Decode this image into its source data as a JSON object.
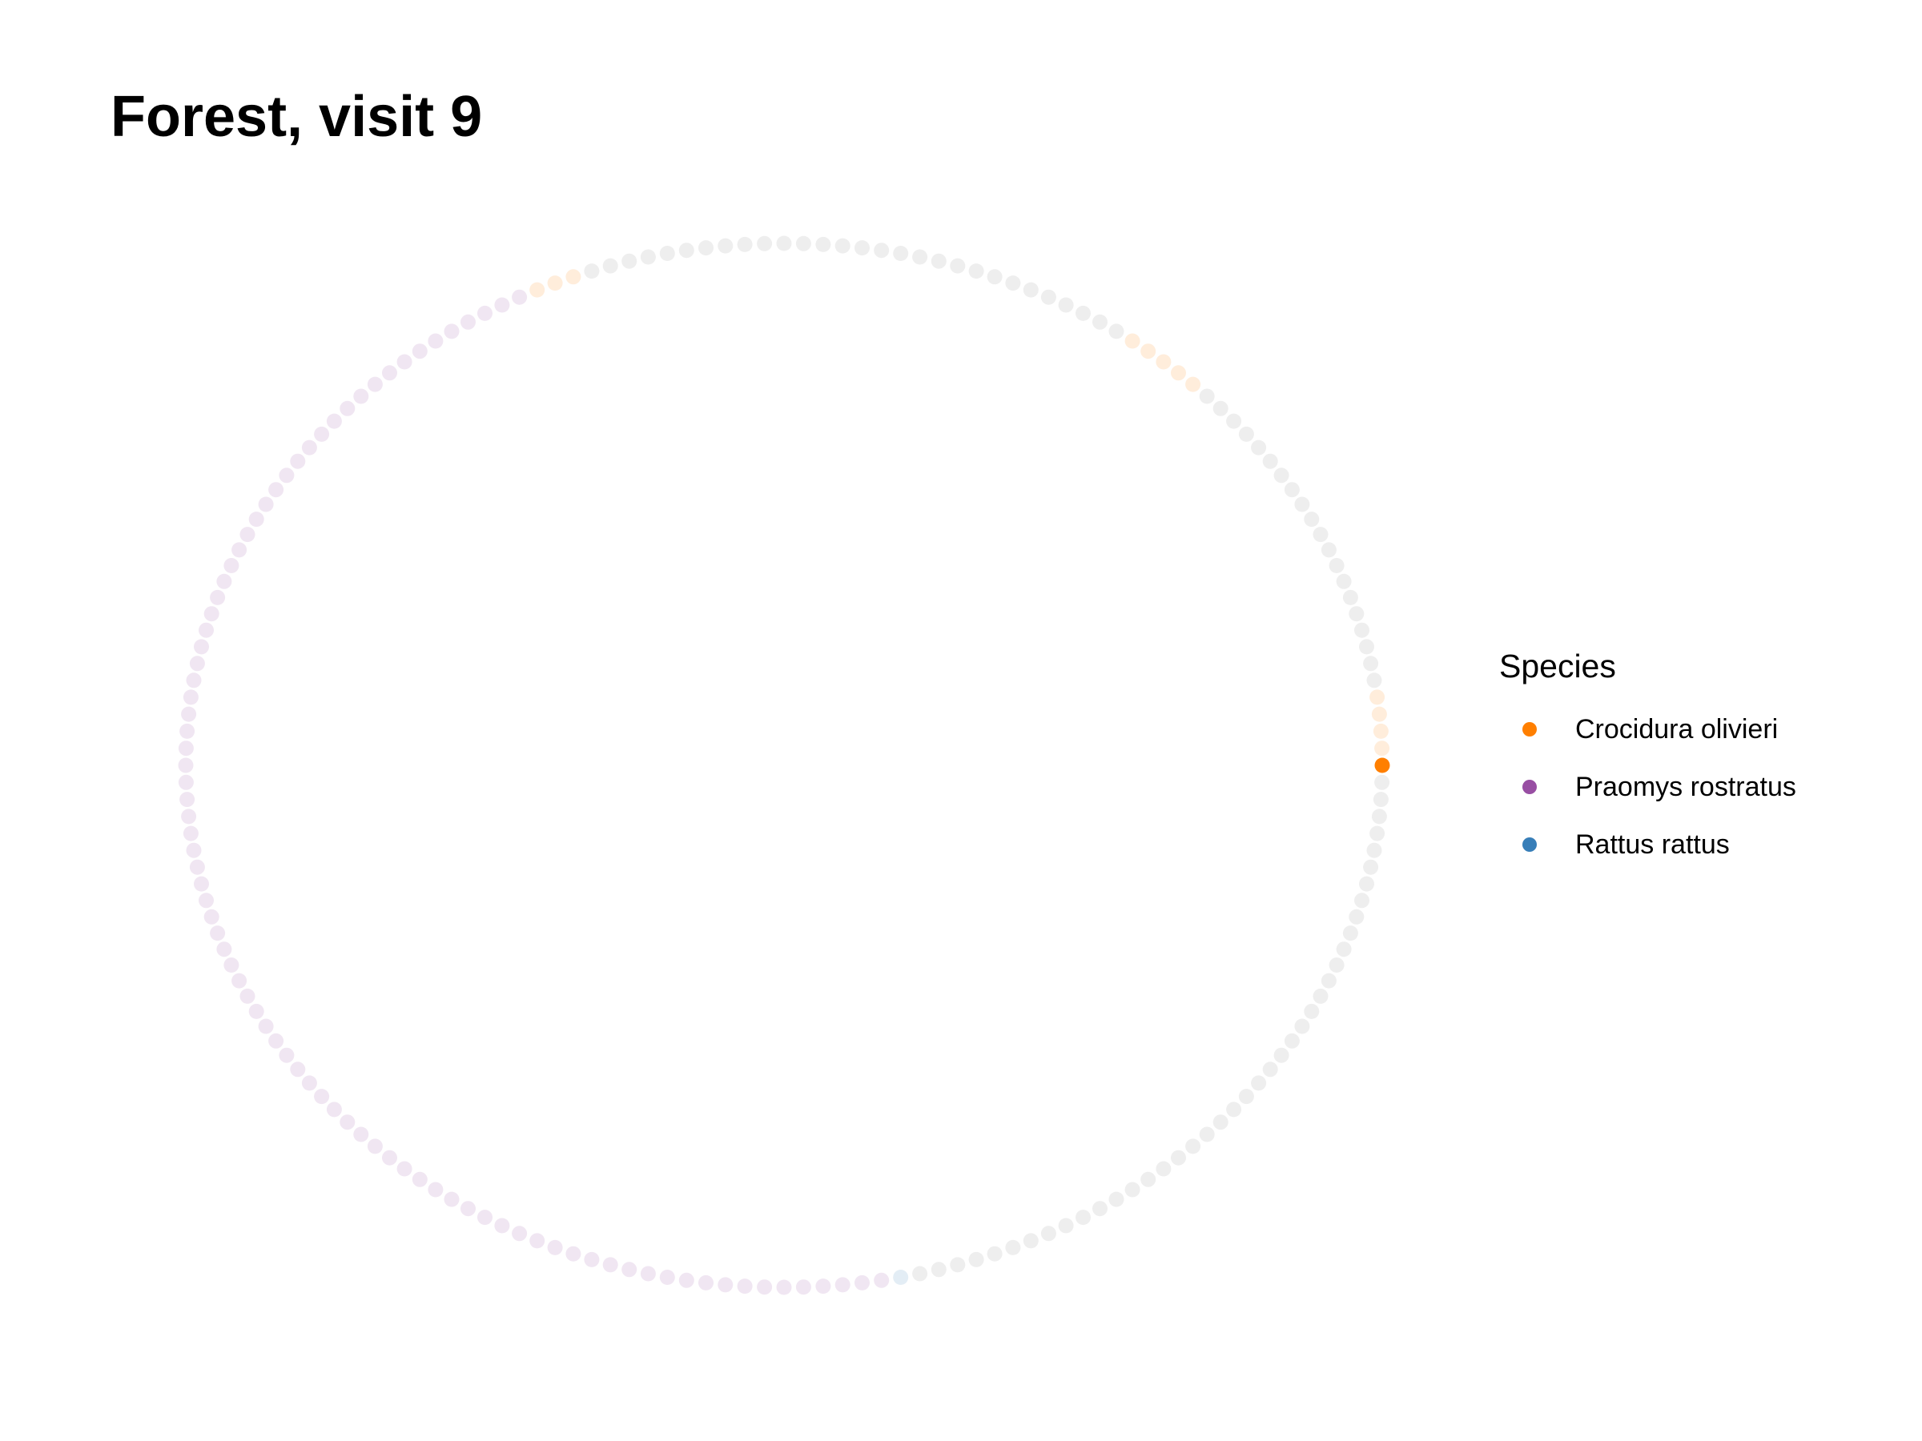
{
  "chart_data": {
    "type": "scatter",
    "subtype": "circular-dot-ring",
    "title": "Forest, visit 9",
    "legend": {
      "title": "Species",
      "placement": "right",
      "entries": [
        {
          "name": "Crocidura olivieri",
          "color": "#FF7F00"
        },
        {
          "name": "Praomys rostratus",
          "color": "#984EA3"
        },
        {
          "name": "Rattus rattus",
          "color": "#377EB8"
        }
      ]
    },
    "grid": false,
    "axes_visible": false,
    "point_count": 192,
    "highlighted_index": 0,
    "colors": {
      "faded": "#D9D9D9"
    },
    "segments": [
      {
        "species": null,
        "start": 0,
        "end": 0,
        "highlight": true,
        "comment_species": "Crocidura olivieri"
      },
      {
        "species": "Crocidura olivieri",
        "start": 1,
        "end": 4
      },
      {
        "species": null,
        "start": 5,
        "end": 24
      },
      {
        "species": "Crocidura olivieri",
        "start": 25,
        "end": 29
      },
      {
        "species": null,
        "start": 30,
        "end": 58
      },
      {
        "species": "Crocidura olivieri",
        "start": 59,
        "end": 61
      },
      {
        "species": "Praomys rostratus",
        "start": 62,
        "end": 130
      },
      {
        "species": "Praomys rostratus",
        "start": 131,
        "end": 149
      },
      {
        "species": "Rattus rattus",
        "start": 150,
        "end": 150
      },
      {
        "species": null,
        "start": 151,
        "end": 191
      }
    ]
  }
}
